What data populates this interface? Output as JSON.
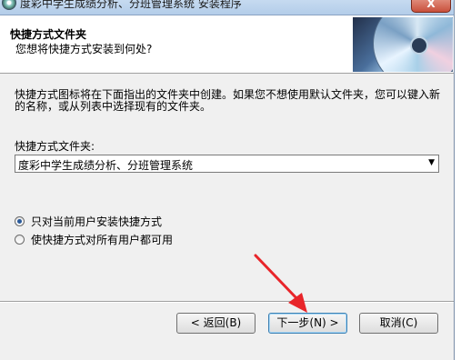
{
  "window": {
    "title": "度彩中学生成绩分析、分班管理系统 安装程序",
    "close_label": "X"
  },
  "header": {
    "title": "快捷方式文件夹",
    "subtitle": "您想将快捷方式安装到何处?"
  },
  "body": {
    "description": "快捷方式图标将在下面指出的文件夹中创建。如果您不想使用默认文件夹，您可以键入新的名称，或从列表中选择现有的文件夹。",
    "folder_label": "快捷方式文件夹:",
    "folder_value": "度彩中学生成绩分析、分班管理系统",
    "radio_options": [
      {
        "label": "只对当前用户安装快捷方式",
        "checked": true
      },
      {
        "label": "使快捷方式对所有用户都可用",
        "checked": false
      }
    ]
  },
  "buttons": {
    "back": "< 返回(B)",
    "next": "下一步(N) >",
    "cancel": "取消(C)"
  },
  "colors": {
    "annotation_arrow": "#e8252a"
  }
}
